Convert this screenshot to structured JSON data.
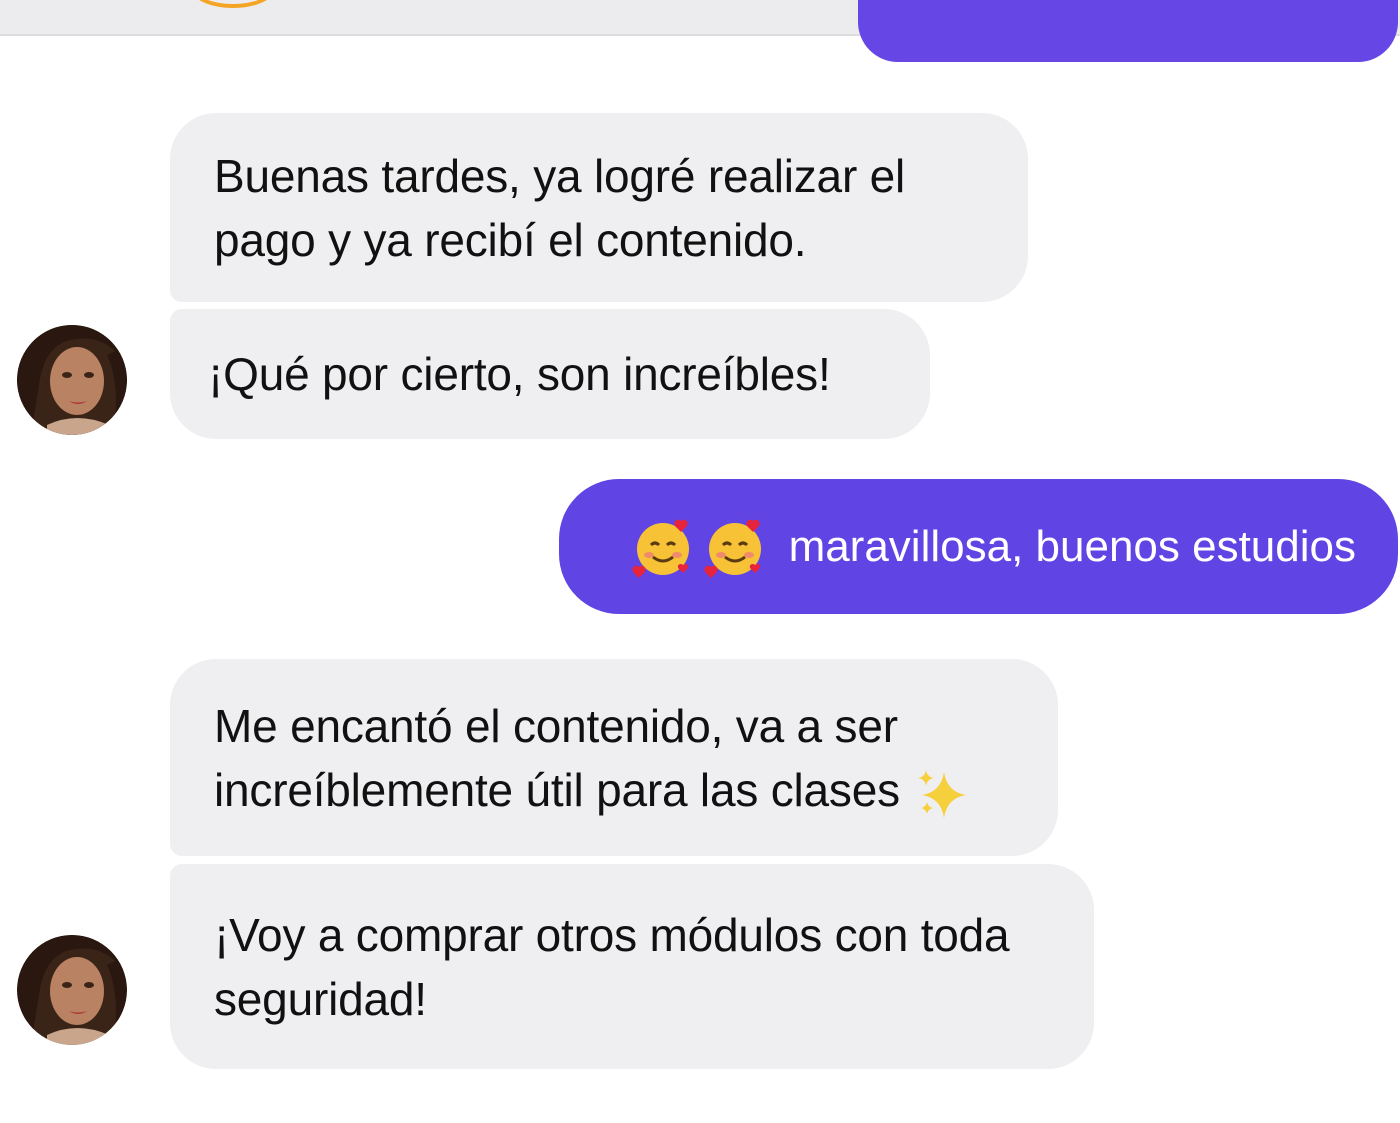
{
  "messages": {
    "m1": {
      "text": "Buenas tardes, ya logré realizar el\npago y ya recibí el contenido."
    },
    "m2": {
      "text": "¡Qué por cierto, son increíbles!"
    },
    "m3": {
      "emoji": [
        "smiling-face-with-hearts",
        "smiling-face-with-hearts"
      ],
      "text": "maravillosa, buenos estudios"
    },
    "m4": {
      "text": "Me encantó el contenido, va a ser\nincreíblemente útil para las clases",
      "emoji": "sparkles"
    },
    "m5": {
      "text": "¡Voy a comprar otros módulos con toda\nseguridad!"
    }
  },
  "colors": {
    "incoming_bubble": "#efeff1",
    "outgoing_bubble": "#6144e4",
    "outgoing_text": "#ffffff",
    "incoming_text": "#111111",
    "header_bg": "#ececee"
  }
}
